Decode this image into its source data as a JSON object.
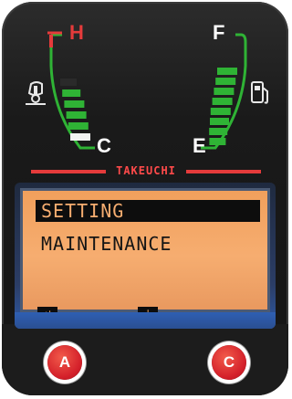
{
  "temperature_gauge": {
    "hot_label": "H",
    "cold_label": "C",
    "icon": "coolant-temperature-icon",
    "bars_lit": 5,
    "bars_total": 6
  },
  "fuel_gauge": {
    "full_label": "F",
    "empty_label": "E",
    "icon": "fuel-pump-icon",
    "bars_lit": 8,
    "bars_total": 8
  },
  "brand": "TAKEUCHI",
  "lcd": {
    "menu": [
      {
        "label": "SETTING",
        "selected": true
      },
      {
        "label": "MAINTENANCE",
        "selected": false
      }
    ],
    "softkeys": [
      {
        "icon": "enter-icon",
        "glyph": "↵"
      },
      {
        "icon": "down-arrow-icon",
        "glyph": "↓"
      }
    ]
  },
  "buttons": {
    "a_label": "A",
    "c_label": "C"
  },
  "colors": {
    "accent_red": "#e53b3b",
    "gauge_green": "#2fb335",
    "lcd_orange": "#f6ad70",
    "button_red": "#d4202a"
  }
}
